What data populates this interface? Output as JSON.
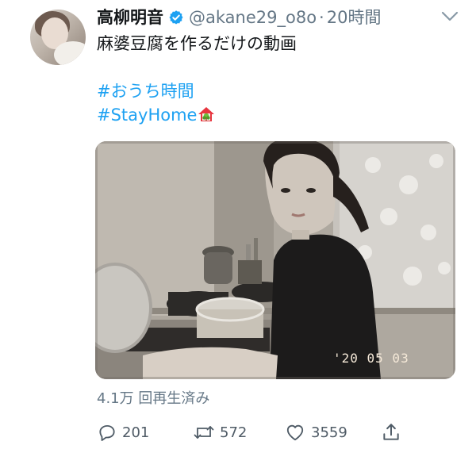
{
  "user": {
    "display_name": "高柳明音",
    "handle": "@akane29_o8o",
    "separator": "·",
    "time": "20時間"
  },
  "tweet": {
    "text_line1": "麻婆豆腐を作るだけの動画",
    "hashtag1": "#おうち時間",
    "hashtag2": "#StayHome"
  },
  "video": {
    "timestamp": "'20 05 03"
  },
  "stats": {
    "views": "4.1万 回再生済み"
  },
  "actions": {
    "reply_count": "201",
    "retweet_count": "572",
    "like_count": "3559"
  },
  "colors": {
    "link": "#1da1f2",
    "secondary_text": "#657786",
    "verified": "#1da1f2"
  },
  "icons": {
    "verified": "verified-badge-icon",
    "caret": "chevron-down-icon",
    "house": "house-with-garden-emoji",
    "reply": "reply-icon",
    "retweet": "retweet-icon",
    "like": "heart-icon",
    "share": "share-icon"
  }
}
